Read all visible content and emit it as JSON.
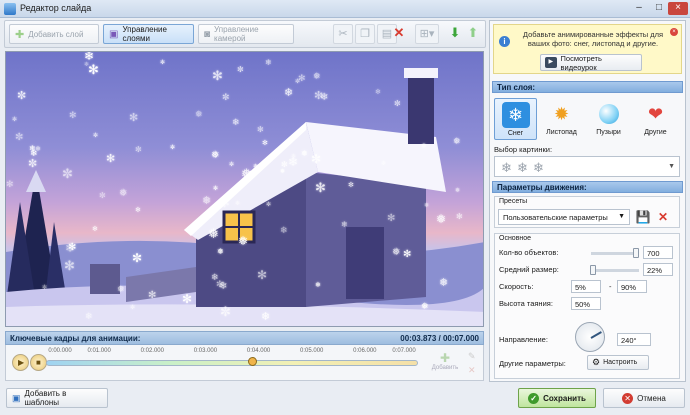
{
  "window": {
    "title": "Редактор слайда"
  },
  "toolbar": {
    "add_layer_label": "Добавить слой",
    "manage_layers_label": "Управление слоями",
    "manage_camera_label": "Управление камерой"
  },
  "timeline": {
    "title": "Ключевые кадры для анимации:",
    "time_display": "00:03.873 / 00:07.000",
    "ticks": [
      "0:00.000",
      "0:01.000",
      "0:02.000",
      "0:03.000",
      "0:04.000",
      "0:05.000",
      "0:06.000",
      "0:07.000"
    ],
    "add_label": "Добавить",
    "playhead_fraction": 0.553
  },
  "bottom": {
    "add_template_label": "Добавить в шаблоны",
    "save_label": "Сохранить",
    "cancel_label": "Отмена"
  },
  "panel": {
    "hint_text": "Добавьте анимированные эффекты для ваших фото: снег, листопад и другие.",
    "watch_video_label": "Посмотреть видеоурок",
    "layer_type_title": "Тип слоя:",
    "layer_types": [
      {
        "label": "Снег",
        "icon": "snowflake-icon"
      },
      {
        "label": "Листопад",
        "icon": "leaf-icon"
      },
      {
        "label": "Пузыри",
        "icon": "bubble-icon"
      },
      {
        "label": "Другие",
        "icon": "hearts-icon"
      }
    ],
    "picture_label": "Выбор картинки:",
    "motion_title": "Параметры движения:",
    "presets_label": "Пресеты",
    "preset_value": "Пользовательские параметры",
    "basic_label": "Основное",
    "params": {
      "count_label": "Кол-во объектов:",
      "count_value": "700",
      "count_fraction": 0.93,
      "size_label": "Средний размер:",
      "size_value": "22%",
      "size_fraction": 0.05,
      "speed_label": "Скорость:",
      "speed_min": "5%",
      "speed_sep": "-",
      "speed_max": "90%",
      "melt_label": "Высота таяния:",
      "melt_value": "50%",
      "direction_label": "Направление:",
      "direction_value": "240°",
      "direction_degrees": 240,
      "other_label": "Другие параметры:",
      "configure_label": "Настроить"
    }
  },
  "colors": {
    "accent": "#9ebde0",
    "save_green": "#bfe59e",
    "close_red": "#c9463d"
  }
}
